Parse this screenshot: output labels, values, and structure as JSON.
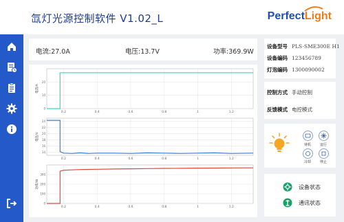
{
  "app": {
    "title": "氙灯光源控制软件 V1.02_L",
    "logo_part1": "Perfect",
    "logo_part2": "Light"
  },
  "sidebar": {
    "items": [
      {
        "name": "home",
        "icon": "home-icon"
      },
      {
        "name": "history",
        "icon": "history-icon"
      },
      {
        "name": "records",
        "icon": "clipboard-icon"
      },
      {
        "name": "settings",
        "icon": "gear-icon"
      },
      {
        "name": "about",
        "icon": "info-icon"
      }
    ],
    "exit_icon": "exit-icon"
  },
  "readout": {
    "current": "电流:27.0A",
    "voltage": "电压:13.7V",
    "power": "功率:369.9W"
  },
  "device": {
    "model_label": "设备型号",
    "model_value": "PLS-SME300E H1",
    "code_label": "设备编码",
    "code_value": "123456789",
    "bulb_label": "灯泡编码",
    "bulb_value": "1300090002"
  },
  "control": {
    "mode_label": "控制方式",
    "mode_value": "手动控制",
    "feedback_label": "反馈模式",
    "feedback_value": "电控模式"
  },
  "state_buttons": {
    "standby": "待机",
    "running": "运行",
    "cooling": "冷却",
    "stopped": "停止"
  },
  "status": {
    "device_status": "设备状态",
    "comm_status": "通讯状态"
  },
  "colors": {
    "accent": "#2459c9",
    "current_line": "#3dd6b4",
    "voltage_line": "#3b7ed6",
    "power_line": "#d9483a",
    "status_green": "#1a9e6a",
    "lamp": "#f5a623"
  },
  "chart_data": [
    {
      "type": "line",
      "ylabel": "电流/A",
      "x_ticks": [
        "0.2",
        "0.4",
        "0.6",
        "0.8",
        "1",
        "1.2"
      ],
      "y_ticks": [
        "0",
        "10",
        "20"
      ],
      "ylim": [
        0,
        30
      ],
      "xlim": [
        0.1,
        1.33
      ],
      "grid": true,
      "x": [
        0.1,
        0.179,
        0.179,
        0.3,
        0.5,
        0.7,
        0.9,
        1.1,
        1.33
      ],
      "y": [
        0,
        0,
        27,
        27,
        27,
        27,
        27,
        27,
        27
      ]
    },
    {
      "type": "line",
      "ylabel": "电压/V",
      "x_ticks": [
        "0.2",
        "0.4",
        "0.6",
        "0.8",
        "1",
        "1.2"
      ],
      "y_ticks": [
        "14",
        "16",
        "18",
        "20",
        "22",
        "24"
      ],
      "ylim": [
        13,
        25
      ],
      "xlim": [
        0.1,
        1.33
      ],
      "grid": true,
      "x": [
        0.1,
        0.179,
        0.179,
        0.2,
        0.25,
        0.3,
        0.35,
        0.4,
        0.5,
        0.6,
        0.7,
        0.8,
        0.9,
        1.0,
        1.1,
        1.2,
        1.33
      ],
      "y": [
        24.3,
        24.3,
        14.2,
        13.7,
        13.6,
        13.8,
        13.6,
        13.7,
        13.7,
        13.6,
        13.8,
        13.7,
        13.6,
        13.7,
        13.8,
        13.6,
        13.7
      ]
    },
    {
      "type": "line",
      "ylabel": "功率/W",
      "x_ticks": [
        "0.2",
        "0.4",
        "0.6",
        "0.8",
        "1",
        "1.2"
      ],
      "y_ticks": [
        "0",
        "100",
        "200",
        "300"
      ],
      "ylim": [
        0,
        400
      ],
      "xlim": [
        0.1,
        1.33
      ],
      "grid": true,
      "x": [
        0.1,
        0.179,
        0.179,
        0.2,
        0.3,
        0.4,
        0.5,
        0.6,
        0.7,
        0.8,
        0.9,
        1.0,
        1.1,
        1.2,
        1.33
      ],
      "y": [
        0,
        0,
        335,
        345,
        352,
        355,
        358,
        360,
        362,
        364,
        365,
        367,
        368,
        369,
        370
      ]
    }
  ]
}
